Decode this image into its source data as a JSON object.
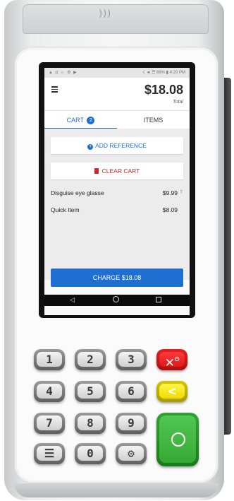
{
  "device": {
    "nfc_symbol": ")))"
  },
  "status_bar": {
    "left_icons": "▲ ◘ ☼ ⚙ ▶",
    "right_text": "☇ ◄ ☰ 88% ▮ 4:20 PM"
  },
  "header": {
    "total_amount": "$18.08",
    "total_label": "Total"
  },
  "tabs": [
    {
      "label": "CART",
      "badge": "2",
      "active": true
    },
    {
      "label": "ITEMS",
      "active": false
    }
  ],
  "actions": {
    "add_reference": "ADD REFERENCE",
    "clear_cart": "CLEAR CART"
  },
  "cart_items": [
    {
      "name": "Disguise eye glasse",
      "price": "$9.99",
      "marker": "T"
    },
    {
      "name": "Quick Item",
      "price": "$8.09",
      "marker": ""
    }
  ],
  "charge_button": "CHARGE $18.08",
  "keypad": {
    "keys": [
      "1",
      "2",
      "3",
      "4",
      "5",
      "6",
      "7",
      "8",
      "9",
      "☰",
      "0",
      "⚙"
    ],
    "cancel_symbol": "✕",
    "cancel_power": "⏻",
    "clear_symbol": "<"
  },
  "colors": {
    "accent": "#1e6fd1",
    "danger": "#d02828",
    "enter_key": "#34aa34",
    "clear_key": "#f0de00",
    "cancel_key": "#e01818"
  }
}
